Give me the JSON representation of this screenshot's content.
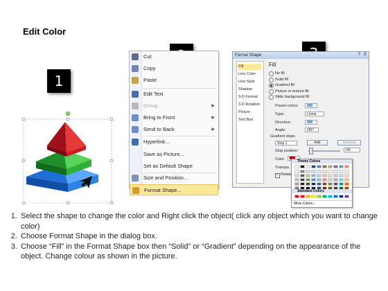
{
  "title": "Edit Color",
  "badges": [
    "1",
    "2",
    "3"
  ],
  "context_menu": {
    "items": [
      {
        "label": "Cut",
        "icon": "scissors-icon",
        "color": "#5b6e8c"
      },
      {
        "label": "Copy",
        "icon": "copy-icon",
        "color": "#6d8ab8"
      },
      {
        "label": "Paste",
        "icon": "clipboard-icon",
        "color": "#c9a24a"
      },
      {
        "label": "Edit Text",
        "icon": "edit-text-icon",
        "color": "#4a6ea8"
      },
      {
        "label": "Group",
        "icon": "group-icon",
        "color": "#b8b8b8",
        "submenu": true,
        "disabled": true
      },
      {
        "label": "Bring to Front",
        "icon": "bring-to-front-icon",
        "color": "#6b8fc7",
        "submenu": true
      },
      {
        "label": "Send to Back",
        "icon": "send-to-back-icon",
        "color": "#6b8fc7",
        "submenu": true
      },
      {
        "label": "Hyperlink...",
        "icon": "hyperlink-icon",
        "color": "#3a6fb0"
      },
      {
        "label": "Save as Picture...",
        "icon": "",
        "color": ""
      },
      {
        "label": "Set as Default Shape",
        "icon": "",
        "color": ""
      },
      {
        "label": "Size and Position...",
        "icon": "size-position-icon",
        "color": "#7f95b5"
      },
      {
        "label": "Format Shape...",
        "icon": "format-shape-icon",
        "color": "#d69a2a",
        "highlighted": true
      }
    ]
  },
  "dialog": {
    "title": "Format Shape",
    "help": "?",
    "close": "X",
    "categories": [
      "Fill",
      "Line Color",
      "Line Style",
      "Shadow",
      "3-D Format",
      "3-D Rotation",
      "Picture",
      "Text Box"
    ],
    "pane_title": "Fill",
    "fill_options": [
      "No fill",
      "Solid fill",
      "Gradient fill",
      "Picture or texture fill",
      "Slide background fill"
    ],
    "selected_fill": "Gradient fill",
    "preset_label": "Preset colors:",
    "type_label": "Type:",
    "type_value": "Linear",
    "direction_label": "Direction:",
    "angle_label": "Angle:",
    "angle_value": "180°",
    "stops_label": "Gradient stops",
    "stop_value": "Stop 1",
    "add_label": "Add",
    "remove_label": "Remove",
    "stop_pos_label": "Stop position:",
    "stop_pos_value": "0%",
    "color_label": "Color:",
    "transparency_label": "Transpa",
    "rotate_label": "Rotate"
  },
  "palette": {
    "theme_label": "Theme Colors",
    "standard_label": "Standard Colors",
    "more_label": "More Colors...",
    "theme_top": [
      "#ffffff",
      "#000000",
      "#eeece1",
      "#1f497d",
      "#4f81bd",
      "#c0504d",
      "#9bbb59",
      "#8064a2",
      "#4bacc6",
      "#f79646"
    ],
    "theme_shades": [
      [
        "#f2f2f2",
        "#7f7f7f",
        "#ddd9c3",
        "#c6d9f0",
        "#dbe5f1",
        "#f2dcdb",
        "#ebf1dd",
        "#e5e0ec",
        "#dbeef3",
        "#fdeada"
      ],
      [
        "#d8d8d8",
        "#595959",
        "#c4bd97",
        "#8db3e2",
        "#b8cce4",
        "#e5b9b7",
        "#d7e3bc",
        "#ccc1d9",
        "#b7dde8",
        "#fbd5b5"
      ],
      [
        "#bfbfbf",
        "#3f3f3f",
        "#938953",
        "#548dd4",
        "#95b3d7",
        "#d99694",
        "#c3d69b",
        "#b2a2c7",
        "#92cddc",
        "#fac08f"
      ],
      [
        "#a5a5a5",
        "#262626",
        "#494429",
        "#17365d",
        "#366092",
        "#953734",
        "#76923c",
        "#5f497a",
        "#31859b",
        "#e36c09"
      ],
      [
        "#7f7f7f",
        "#0c0c0c",
        "#1d1b10",
        "#0f243e",
        "#244061",
        "#632423",
        "#4f6128",
        "#3f3151",
        "#205867",
        "#974806"
      ]
    ],
    "standard": [
      "#c00000",
      "#ff0000",
      "#ffc000",
      "#ffff00",
      "#92d050",
      "#00b050",
      "#00b0f0",
      "#0070c0",
      "#002060",
      "#7030a0"
    ]
  },
  "instructions": [
    "Select the shape to change the color and Right click the object( click any object which you want to change color)",
    "Choose Format Shape in the dialog box.",
    "Choose “Fill” in the Format Shape box then “Solid” or “Gradient” depending on the appearance of the object. Change colour as shown in the picture."
  ]
}
